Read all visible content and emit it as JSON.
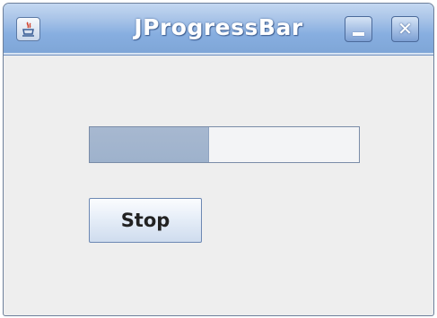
{
  "window": {
    "title": "JProgressBar",
    "controls": {
      "minimize_icon": "minimize-icon",
      "close_glyph": "✕"
    },
    "app_icon": "java-cup-icon"
  },
  "progress_bar": {
    "value_fraction": 0.44
  },
  "stop_button": {
    "label": "Stop"
  },
  "colors": {
    "titlebar": "#87aee0",
    "background": "#eeeeee",
    "progress_fill": "#a3b5cd"
  }
}
